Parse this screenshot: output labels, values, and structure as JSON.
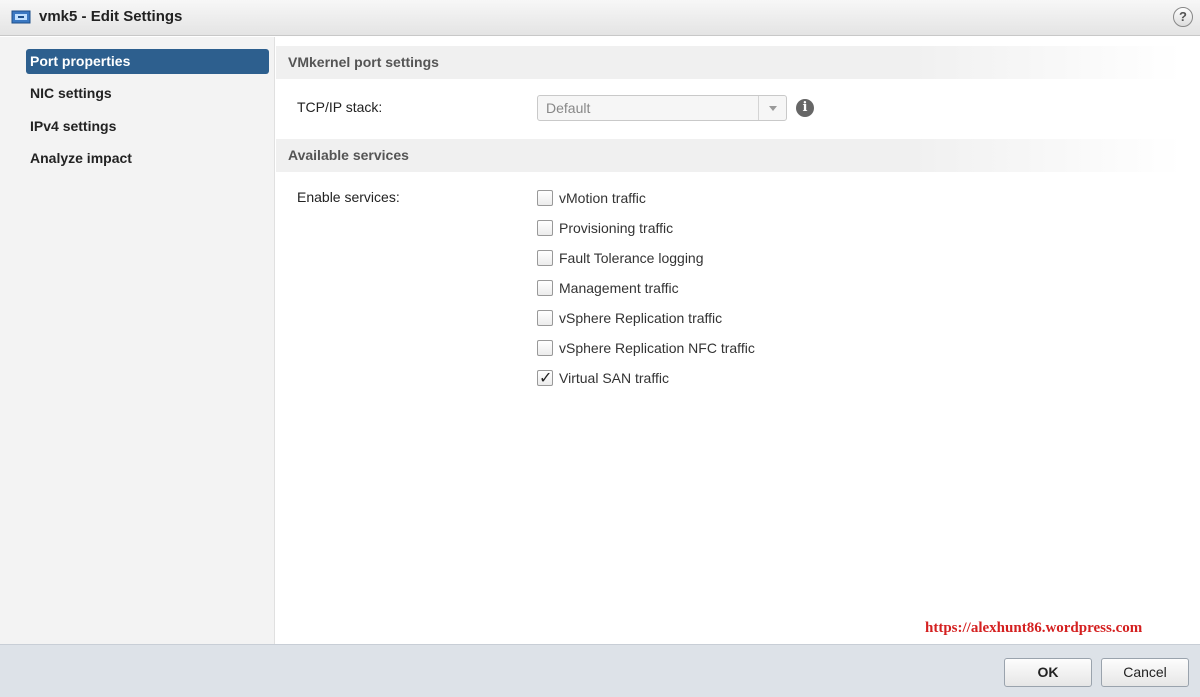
{
  "window": {
    "title": "vmk5 - Edit Settings",
    "help_label": "?"
  },
  "sidebar": {
    "items": [
      {
        "label": "Port properties",
        "active": true
      },
      {
        "label": "NIC settings"
      },
      {
        "label": "IPv4 settings"
      },
      {
        "label": "Analyze impact"
      }
    ]
  },
  "main": {
    "vmkernel_section": {
      "title": "VMkernel port settings",
      "tcpip_label": "TCP/IP stack:",
      "tcpip_value": "Default"
    },
    "services_section": {
      "title": "Available services",
      "enable_label": "Enable services:",
      "services": [
        {
          "label": "vMotion traffic",
          "checked": false
        },
        {
          "label": "Provisioning traffic",
          "checked": false
        },
        {
          "label": "Fault Tolerance logging",
          "checked": false
        },
        {
          "label": "Management traffic",
          "checked": false
        },
        {
          "label": "vSphere Replication traffic",
          "checked": false
        },
        {
          "label": "vSphere Replication NFC traffic",
          "checked": false
        },
        {
          "label": "Virtual SAN traffic",
          "checked": true
        }
      ]
    }
  },
  "watermark": "https://alexhunt86.wordpress.com",
  "footer": {
    "ok_label": "OK",
    "cancel_label": "Cancel"
  },
  "colors": {
    "active_nav": "#2d5f8e",
    "watermark": "#d42020",
    "footer_bg": "#dde2e8"
  }
}
